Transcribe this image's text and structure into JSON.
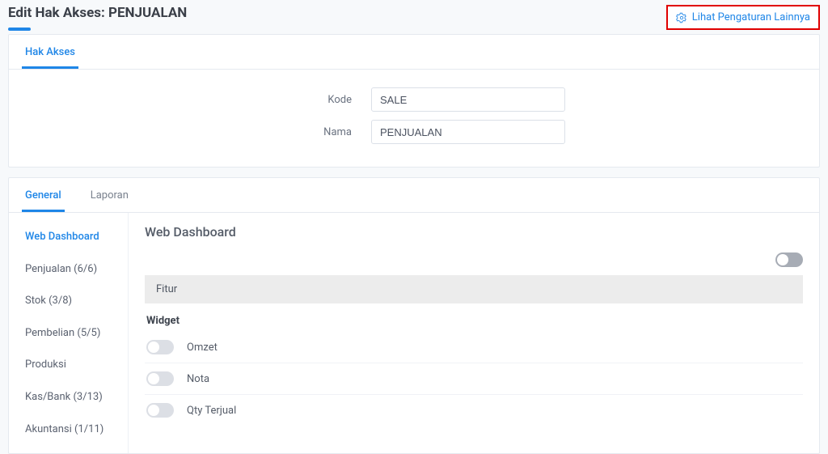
{
  "header": {
    "title": "Edit Hak Akses: PENJUALAN",
    "settings_link": "Lihat Pengaturan Lainnya"
  },
  "form_card": {
    "tab_label": "Hak Akses",
    "rows": [
      {
        "label": "Kode",
        "value": "SALE"
      },
      {
        "label": "Nama",
        "value": "PENJUALAN"
      }
    ]
  },
  "detail": {
    "tabs": [
      "General",
      "Laporan"
    ],
    "active_tab": "General",
    "sidebar_items": [
      "Web Dashboard",
      "Penjualan (6/6)",
      "Stok (3/8)",
      "Pembelian (5/5)",
      "Produksi",
      "Kas/Bank (3/13)",
      "Akuntansi (1/11)"
    ],
    "active_sidebar": "Web Dashboard",
    "section_title": "Web Dashboard",
    "feature_band": "Fitur",
    "subhead": "Widget",
    "features": [
      "Omzet",
      "Nota",
      "Qty Terjual"
    ]
  }
}
